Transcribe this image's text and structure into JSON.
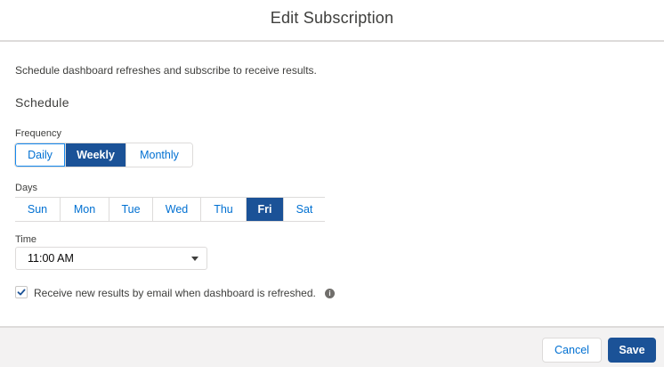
{
  "modal": {
    "title": "Edit Subscription"
  },
  "body": {
    "intro": "Schedule dashboard refreshes and subscribe to receive results.",
    "section_title": "Schedule"
  },
  "frequency": {
    "label": "Frequency",
    "options": [
      "Daily",
      "Weekly",
      "Monthly"
    ],
    "selected": "Weekly"
  },
  "days": {
    "label": "Days",
    "options": [
      "Sun",
      "Mon",
      "Tue",
      "Wed",
      "Thu",
      "Fri",
      "Sat"
    ],
    "selected": "Fri"
  },
  "time": {
    "label": "Time",
    "value": "11:00 AM"
  },
  "email_option": {
    "checked": true,
    "label": "Receive new results by email when dashboard is refreshed.",
    "info_icon": "info-icon"
  },
  "footer": {
    "cancel_label": "Cancel",
    "save_label": "Save"
  },
  "colors": {
    "brand": "#1b5297",
    "link": "#0070d2",
    "border": "#dddbda",
    "footer_bg": "#f3f2f2"
  }
}
